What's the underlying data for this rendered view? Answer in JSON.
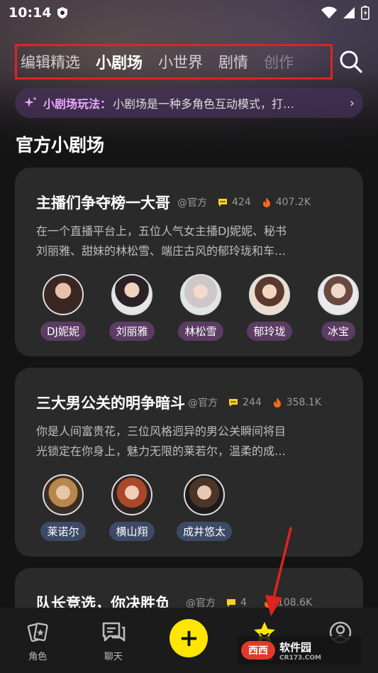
{
  "status_bar": {
    "time": "10:14"
  },
  "tabs": [
    {
      "label": "编辑精选",
      "state": "normal"
    },
    {
      "label": "小剧场",
      "state": "active"
    },
    {
      "label": "小世界",
      "state": "normal"
    },
    {
      "label": "剧情",
      "state": "normal"
    },
    {
      "label": "创作",
      "state": "faded"
    }
  ],
  "intro": {
    "title": "小剧场玩法：",
    "text": "小剧场是一种多角色互动模式，打…",
    "chevron": "›"
  },
  "section_title": "官方小剧场",
  "cards": [
    {
      "title": "主播们争夺榜一大哥",
      "author": "@官方",
      "chats": "424",
      "heat": "407.2K",
      "desc_line1": "在一个直播平台上，五位人气女主播DJ妮妮、秘书",
      "desc_line2": "刘丽雅、甜妹的林松雪、端庄古风的郁玲珑和车…",
      "characters": [
        {
          "name": "DJ妮妮"
        },
        {
          "name": "刘丽雅"
        },
        {
          "name": "林松雪"
        },
        {
          "name": "郁玲珑"
        },
        {
          "name": "冰宝"
        }
      ]
    },
    {
      "title": "三大男公关的明争暗斗",
      "author": "@官方",
      "chats": "244",
      "heat": "358.1K",
      "desc_line1": "你是人间富贵花，三位风格迥异的男公关瞬间将目",
      "desc_line2": "光锁定在你身上，魅力无限的莱若尔，温柔的成…",
      "characters": [
        {
          "name": "莱诺尔"
        },
        {
          "name": "横山翔"
        },
        {
          "name": "成井悠太"
        }
      ]
    },
    {
      "title": "队长竞选，你决胜负",
      "author": "@官方",
      "chats": "4",
      "heat": "108.6K"
    }
  ],
  "bottom_nav": {
    "role_label": "角色",
    "chat_label": "聊天",
    "add_label": "+",
    "star_label": "发现",
    "profile_label": ""
  },
  "watermark": {
    "logo": "西西",
    "text": "软件园",
    "sub": "CR173.COM"
  },
  "colors": {
    "accent": "#ffe600",
    "highlight_box": "#e0231f",
    "intro_title": "#e9a8ff"
  }
}
